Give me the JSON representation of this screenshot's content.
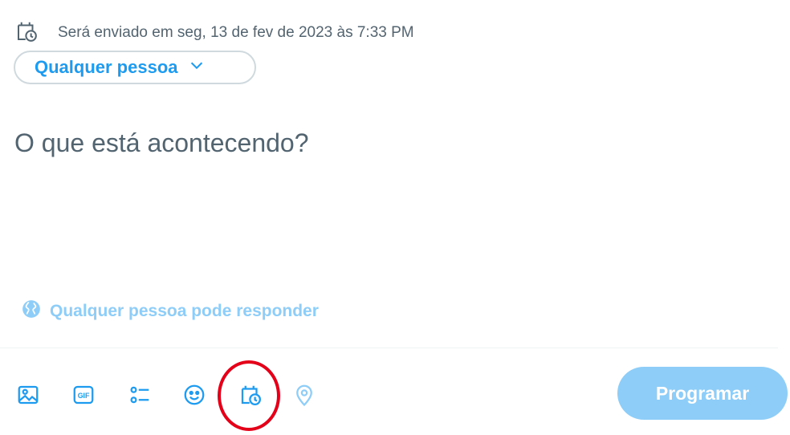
{
  "schedule": {
    "icon": "calendar-clock-icon",
    "text": "Será enviado em seg, 13 de fev de 2023 às 7:33 PM"
  },
  "audience": {
    "label": "Qualquer pessoa",
    "icon": "chevron-down-icon"
  },
  "compose": {
    "placeholder": "O que está acontecendo?"
  },
  "reply_setting": {
    "icon": "globe-icon",
    "label": "Qualquer pessoa pode responder"
  },
  "toolbar": {
    "tools": [
      "image-icon",
      "gif-icon",
      "poll-icon",
      "emoji-icon",
      "schedule-icon",
      "location-icon"
    ],
    "submit_label": "Programar"
  },
  "colors": {
    "accent": "#1d9bf0",
    "accent_disabled": "#8ecdf7",
    "text_secondary": "#536471",
    "border": "#cfd9de",
    "highlight": "#e5001a"
  }
}
